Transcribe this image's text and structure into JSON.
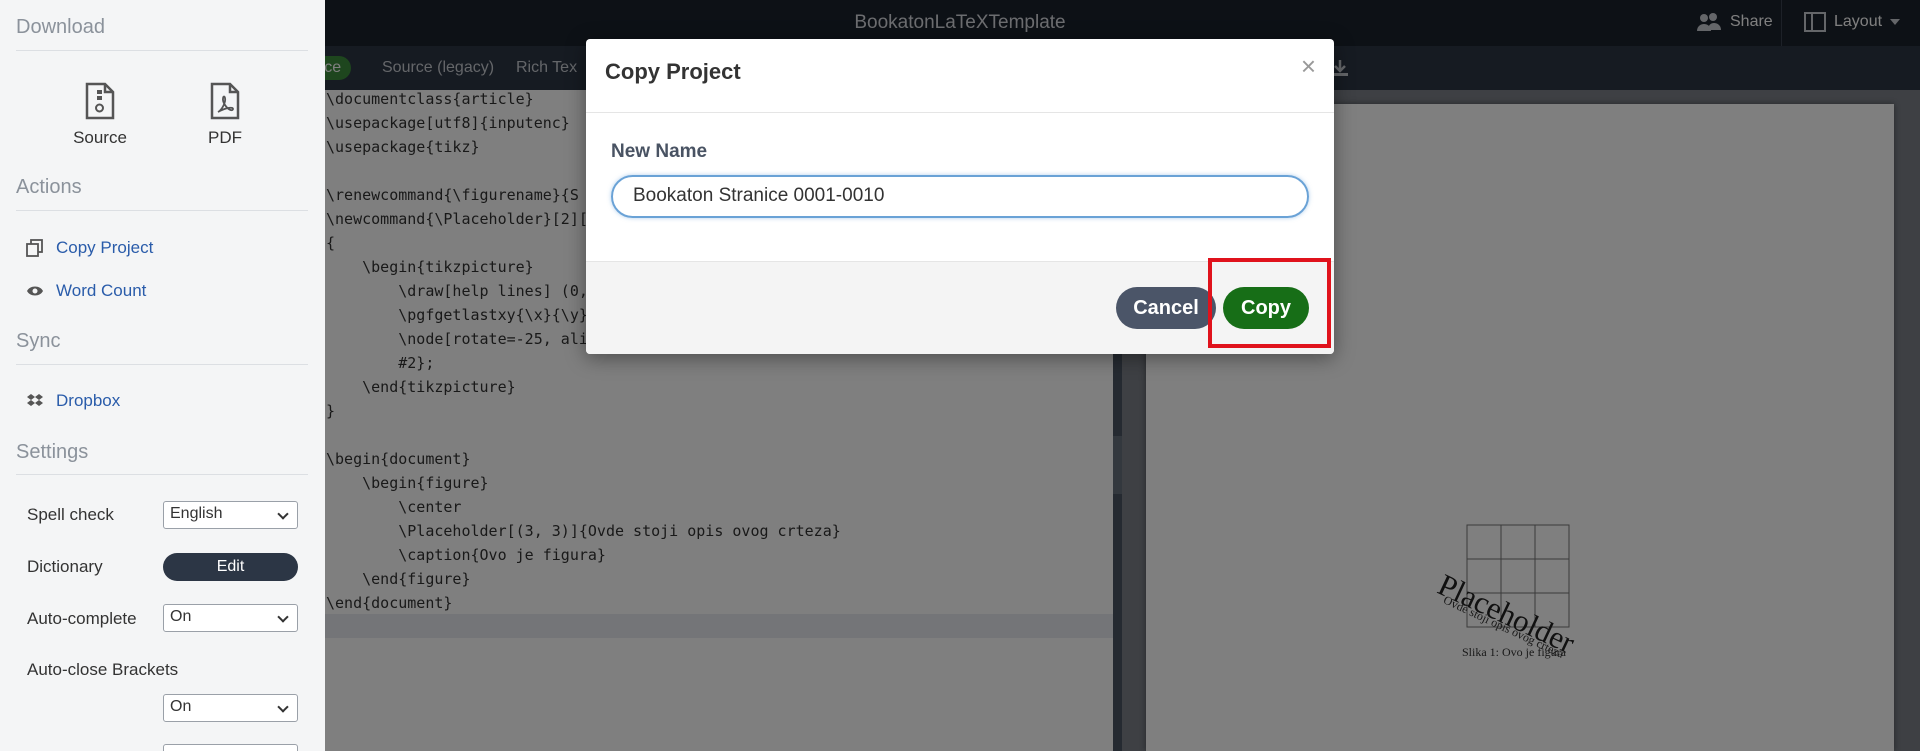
{
  "header": {
    "project_title": "BookatonLaTeXTemplate",
    "share_label": "Share",
    "layout_label": "Layout"
  },
  "editor_tabs": {
    "source": "urce",
    "source_legacy": "Source (legacy)",
    "rich_text": "Rich Tex"
  },
  "code_lines": [
    "\\documentclass{article}",
    "\\usepackage[utf8]{inputenc}",
    "\\usepackage{tikz}",
    "",
    "\\renewcommand{\\figurename}{S",
    "\\newcommand{\\Placeholder}[2][",
    "{",
    "    \\begin{tikzpicture}",
    "        \\draw[help lines] (0,",
    "        \\pgfgetlastxy{\\x}{\\y}",
    "        \\node[rotate=-25, ali",
    "        #2};",
    "    \\end{tikzpicture}",
    "}",
    "",
    "\\begin{document}",
    "    \\begin{figure}",
    "        \\center",
    "        \\Placeholder[(3, 3)]{Ovde stoji opis ovog crteza}",
    "        \\caption{Ovo je figura}",
    "    \\end{figure}",
    "\\end{document}"
  ],
  "pdf": {
    "placeholder_text": "Placeholder",
    "placeholder_sub": "Ovde stoji opis ovog crteza",
    "caption": "Slika 1: Ovo je figura"
  },
  "drawer": {
    "download_title": "Download",
    "source_label": "Source",
    "pdf_label": "PDF",
    "actions_title": "Actions",
    "copy_project_label": "Copy Project",
    "word_count_label": "Word Count",
    "sync_title": "Sync",
    "dropbox_label": "Dropbox",
    "settings_title": "Settings",
    "spell_check_label": "Spell check",
    "spell_check_value": "English",
    "dictionary_label": "Dictionary",
    "dictionary_button": "Edit",
    "auto_complete_label": "Auto-complete",
    "auto_complete_value": "On",
    "auto_close_label": "Auto-close Brackets",
    "auto_close_value": "On"
  },
  "modal": {
    "title": "Copy Project",
    "close_symbol": "×",
    "new_name_label": "New Name",
    "new_name_value": "Bookaton Stranice 0001-0010",
    "cancel_label": "Cancel",
    "copy_label": "Copy"
  },
  "colors": {
    "accent_green": "#176e17",
    "highlight_red": "#e0121c",
    "link_blue": "#2a5caa"
  }
}
